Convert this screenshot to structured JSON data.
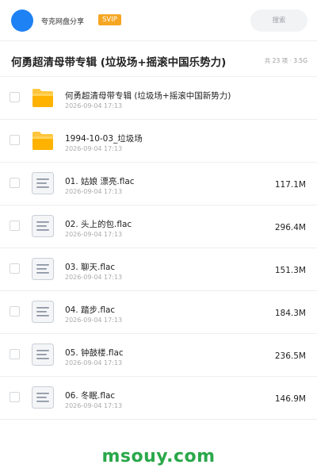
{
  "header": {
    "app_title": "夸克网盘分享",
    "badge": "SVIP",
    "search_label": "搜索"
  },
  "folder": {
    "title": "何勇超清母带专辑 (垃圾场+摇滚中国乐势力)",
    "meta": "共 23 项 · 3.5G"
  },
  "files": [
    {
      "type": "folder",
      "icon": "folder-icon",
      "name": "何勇超清母带专辑 (垃圾场+摇滚中国新势力)",
      "date": "2026-09-04 17:13",
      "size": ""
    },
    {
      "type": "folder",
      "icon": "folder-icon",
      "name": "1994-10-03_垃圾场",
      "date": "2026-09-04 17:13",
      "size": ""
    },
    {
      "type": "file",
      "icon": "document-icon",
      "name": "01. 姑娘 漂亮.flac",
      "date": "2026-09-04 17:13",
      "size": "117.1M"
    },
    {
      "type": "file",
      "icon": "document-icon",
      "name": "02. 头上的包.flac",
      "date": "2026-09-04 17:13",
      "size": "296.4M"
    },
    {
      "type": "file",
      "icon": "document-icon",
      "name": "03. 聊天.flac",
      "date": "2026-09-04 17:13",
      "size": "151.3M"
    },
    {
      "type": "file",
      "icon": "document-icon",
      "name": "04. 踏步.flac",
      "date": "2026-09-04 17:13",
      "size": "184.3M"
    },
    {
      "type": "file",
      "icon": "document-icon",
      "name": "05. 钟鼓楼.flac",
      "date": "2026-09-04 17:13",
      "size": "236.5M"
    },
    {
      "type": "file",
      "icon": "document-icon",
      "name": "06. 冬眠.flac",
      "date": "2026-09-04 17:13",
      "size": "146.9M"
    }
  ],
  "footer": {
    "watermark": "msouy.com"
  },
  "colors": {
    "accent_blue": "#1e82f4",
    "svip_orange": "#f5a623",
    "folder_yellow": "#ffc53d",
    "watermark_green": "#2aa84a"
  }
}
